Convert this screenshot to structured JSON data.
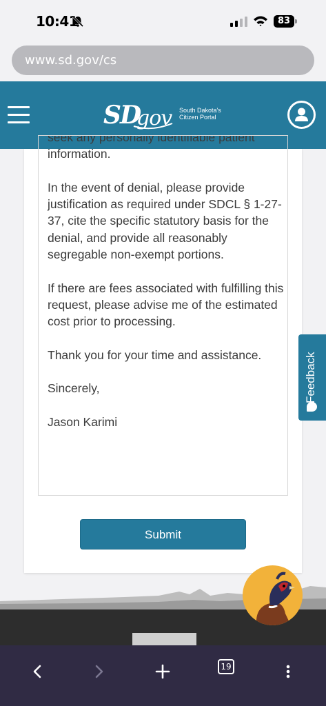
{
  "status_bar": {
    "time": "10:41",
    "battery": "83",
    "icons": [
      "bell-slash-icon",
      "signal-icon",
      "wifi-icon",
      "battery-icon"
    ]
  },
  "browser": {
    "url": "www.sd.gov/cs",
    "tabs_count": "19",
    "icons": [
      "back-icon",
      "forward-icon",
      "new-tab-icon",
      "tabs-icon",
      "more-icon"
    ]
  },
  "header": {
    "logo_text": "SDgov",
    "tagline_line1": "South Dakota's",
    "tagline_line2": "Citizen Portal",
    "icons": [
      "hamburger-menu-icon",
      "account-icon"
    ],
    "background_color": "#257a9c"
  },
  "letter": {
    "paragraphs": [
      "seek any personally identifiable patient information.",
      "In the event of denial, please provide justification as required under SDCL § 1-27-37, cite the specific statutory basis for the denial, and provide all reasonably segregable non-exempt portions.",
      "If there are fees associated with fulfilling this request, please advise me of the estimated cost prior to processing.",
      "Thank you for your time and assistance.",
      "Sincerely,",
      "Jason Karimi"
    ]
  },
  "form": {
    "submit_label": "Submit"
  },
  "feedback": {
    "label": "Feedback",
    "icon": "chat-bubble-icon"
  },
  "mascot": {
    "icon": "pheasant-mascot-icon"
  },
  "colors": {
    "accent": "#257a9c",
    "text": "#3b3b3b",
    "browser_bar": "#302b44"
  }
}
